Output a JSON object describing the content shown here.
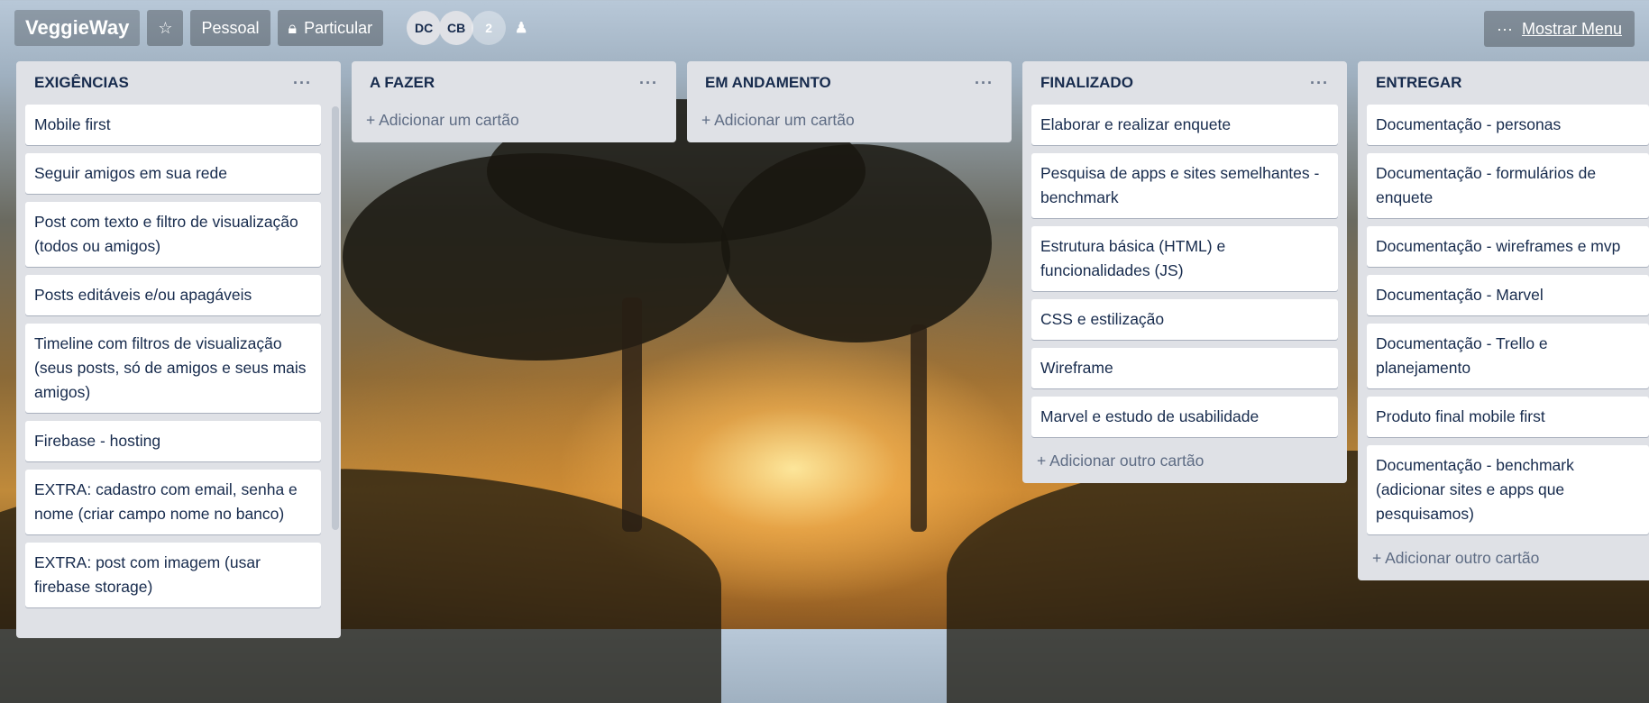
{
  "header": {
    "board_title": "VeggieWay",
    "star_icon": "star-icon",
    "team_label": "Pessoal",
    "visibility_icon": "lock-icon",
    "visibility_label": "Particular",
    "members": [
      "DC",
      "CB"
    ],
    "member_count": "2",
    "invite_icon": "add-member-icon",
    "menu_dots": "···",
    "menu_label": "Mostrar Menu"
  },
  "lists": [
    {
      "title": "EXIGÊNCIAS",
      "menu": "···",
      "cards": [
        "Mobile first",
        "Seguir amigos em sua rede",
        "Post com texto e filtro de visualização (todos ou amigos)",
        "Posts editáveis e/ou apagáveis",
        "Timeline com filtros de visualização (seus posts, só de amigos e seus mais amigos)",
        "Firebase - hosting",
        "EXTRA: cadastro com email, senha e nome (criar campo nome no banco)",
        "EXTRA: post com imagem (usar firebase storage)"
      ]
    },
    {
      "title": "A FAZER",
      "menu": "···",
      "cards": [],
      "add": "+ Adicionar um cartão"
    },
    {
      "title": "EM ANDAMENTO",
      "menu": "···",
      "cards": [],
      "add": "+ Adicionar um cartão"
    },
    {
      "title": "FINALIZADO",
      "menu": "···",
      "cards": [
        "Elaborar e realizar enquete",
        "Pesquisa de apps e sites semelhantes - benchmark",
        "Estrutura básica (HTML) e funcionalidades (JS)",
        "CSS e estilização",
        "Wireframe",
        "Marvel e estudo de usabilidade"
      ],
      "add": "+ Adicionar outro cartão"
    },
    {
      "title": "ENTREGAR",
      "menu": "···",
      "cards": [
        "Documentação - personas",
        "Documentação - formulários de enquete",
        "Documentação - wireframes e mvp",
        "Documentação - Marvel",
        "Documentação - Trello e planejamento",
        "Produto final mobile first",
        "Documentação - benchmark (adicionar sites e apps que pesquisamos)"
      ],
      "add": "+ Adicionar outro cartão"
    }
  ]
}
